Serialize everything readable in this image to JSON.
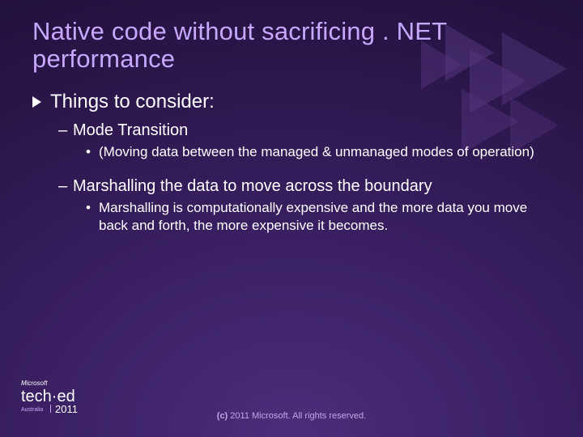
{
  "title": "Native code without sacrificing . NET performance",
  "lvl1": "Things to consider:",
  "items": [
    {
      "heading": "Mode Transition",
      "detail": "(Moving data between the managed & unmanaged modes of operation)"
    },
    {
      "heading": "Marshalling the data to move across the boundary",
      "detail": "Marshalling is computationally expensive and the more data you move back and forth, the more expensive it becomes."
    }
  ],
  "footer": {
    "copyright_bold": "(c)",
    "copyright_rest": " 2011 Microsoft. All rights reserved.",
    "brand_top": "Microsoft",
    "brand_main": "tech·ed",
    "brand_sub": "Australia",
    "brand_year": "2011"
  }
}
